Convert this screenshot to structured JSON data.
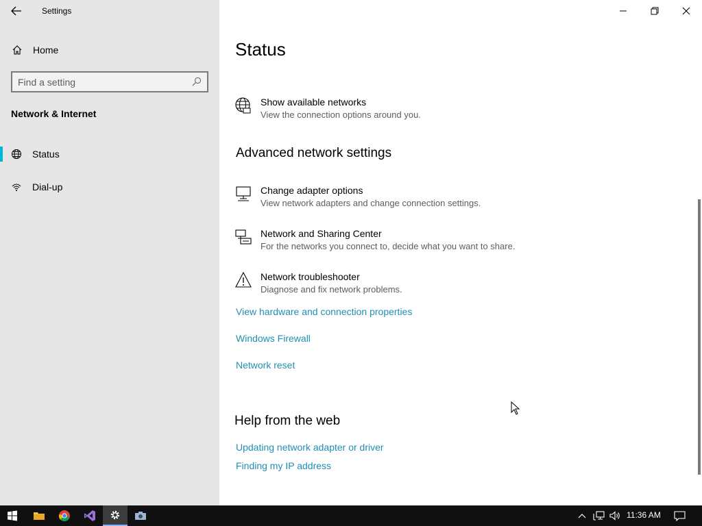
{
  "window": {
    "app_title": "Settings"
  },
  "sidebar": {
    "home_label": "Home",
    "search_placeholder": "Find a setting",
    "section_title": "Network & Internet",
    "items": [
      {
        "label": "Status",
        "icon": "globe-icon",
        "selected": true
      },
      {
        "label": "Dial-up",
        "icon": "dialup-icon",
        "selected": false
      }
    ]
  },
  "main": {
    "title": "Status",
    "show_networks": {
      "title": "Show available networks",
      "desc": "View the connection options around you.",
      "icon": "globe-icon"
    },
    "advanced": {
      "heading": "Advanced network settings",
      "rows": [
        {
          "title": "Change adapter options",
          "desc": "View network adapters and change connection settings.",
          "icon": "adapter-icon"
        },
        {
          "title": "Network and Sharing Center",
          "desc": "For the networks you connect to, decide what you want to share.",
          "icon": "sharing-icon"
        },
        {
          "title": "Network troubleshooter",
          "desc": "Diagnose and fix network problems.",
          "icon": "warning-icon"
        }
      ],
      "links": [
        "View hardware and connection properties",
        "Windows Firewall",
        "Network reset"
      ]
    },
    "help": {
      "heading": "Help from the web",
      "links": [
        "Updating network adapter or driver",
        "Finding my IP address"
      ]
    }
  },
  "taskbar": {
    "apps": [
      "start-icon",
      "file-explorer-icon",
      "chrome-icon",
      "visual-studio-icon",
      "settings-icon",
      "camera-icon"
    ],
    "active_app": "settings-icon",
    "time": "11:36 AM"
  },
  "colors": {
    "accent": "#00b4d6",
    "link": "#1f8fb3",
    "sidebar_bg": "#e6e6e6",
    "taskbar_bg": "#101010"
  }
}
